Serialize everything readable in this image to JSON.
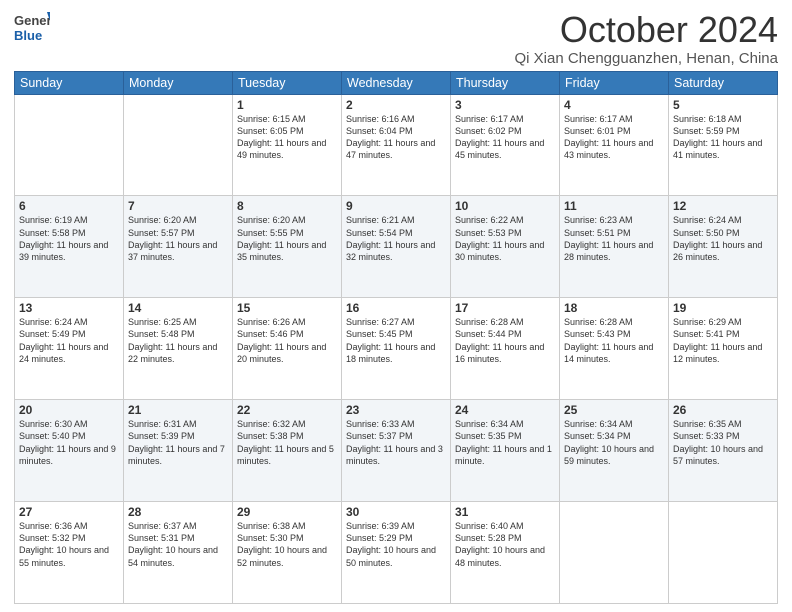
{
  "logo": {
    "text_general": "General",
    "text_blue": "Blue"
  },
  "title": {
    "month": "October 2024",
    "location": "Qi Xian Chengguanzhen, Henan, China"
  },
  "days_of_week": [
    "Sunday",
    "Monday",
    "Tuesday",
    "Wednesday",
    "Thursday",
    "Friday",
    "Saturday"
  ],
  "weeks": [
    [
      {
        "day": "",
        "sunrise": "",
        "sunset": "",
        "daylight": ""
      },
      {
        "day": "",
        "sunrise": "",
        "sunset": "",
        "daylight": ""
      },
      {
        "day": "1",
        "sunrise": "Sunrise: 6:15 AM",
        "sunset": "Sunset: 6:05 PM",
        "daylight": "Daylight: 11 hours and 49 minutes."
      },
      {
        "day": "2",
        "sunrise": "Sunrise: 6:16 AM",
        "sunset": "Sunset: 6:04 PM",
        "daylight": "Daylight: 11 hours and 47 minutes."
      },
      {
        "day": "3",
        "sunrise": "Sunrise: 6:17 AM",
        "sunset": "Sunset: 6:02 PM",
        "daylight": "Daylight: 11 hours and 45 minutes."
      },
      {
        "day": "4",
        "sunrise": "Sunrise: 6:17 AM",
        "sunset": "Sunset: 6:01 PM",
        "daylight": "Daylight: 11 hours and 43 minutes."
      },
      {
        "day": "5",
        "sunrise": "Sunrise: 6:18 AM",
        "sunset": "Sunset: 5:59 PM",
        "daylight": "Daylight: 11 hours and 41 minutes."
      }
    ],
    [
      {
        "day": "6",
        "sunrise": "Sunrise: 6:19 AM",
        "sunset": "Sunset: 5:58 PM",
        "daylight": "Daylight: 11 hours and 39 minutes."
      },
      {
        "day": "7",
        "sunrise": "Sunrise: 6:20 AM",
        "sunset": "Sunset: 5:57 PM",
        "daylight": "Daylight: 11 hours and 37 minutes."
      },
      {
        "day": "8",
        "sunrise": "Sunrise: 6:20 AM",
        "sunset": "Sunset: 5:55 PM",
        "daylight": "Daylight: 11 hours and 35 minutes."
      },
      {
        "day": "9",
        "sunrise": "Sunrise: 6:21 AM",
        "sunset": "Sunset: 5:54 PM",
        "daylight": "Daylight: 11 hours and 32 minutes."
      },
      {
        "day": "10",
        "sunrise": "Sunrise: 6:22 AM",
        "sunset": "Sunset: 5:53 PM",
        "daylight": "Daylight: 11 hours and 30 minutes."
      },
      {
        "day": "11",
        "sunrise": "Sunrise: 6:23 AM",
        "sunset": "Sunset: 5:51 PM",
        "daylight": "Daylight: 11 hours and 28 minutes."
      },
      {
        "day": "12",
        "sunrise": "Sunrise: 6:24 AM",
        "sunset": "Sunset: 5:50 PM",
        "daylight": "Daylight: 11 hours and 26 minutes."
      }
    ],
    [
      {
        "day": "13",
        "sunrise": "Sunrise: 6:24 AM",
        "sunset": "Sunset: 5:49 PM",
        "daylight": "Daylight: 11 hours and 24 minutes."
      },
      {
        "day": "14",
        "sunrise": "Sunrise: 6:25 AM",
        "sunset": "Sunset: 5:48 PM",
        "daylight": "Daylight: 11 hours and 22 minutes."
      },
      {
        "day": "15",
        "sunrise": "Sunrise: 6:26 AM",
        "sunset": "Sunset: 5:46 PM",
        "daylight": "Daylight: 11 hours and 20 minutes."
      },
      {
        "day": "16",
        "sunrise": "Sunrise: 6:27 AM",
        "sunset": "Sunset: 5:45 PM",
        "daylight": "Daylight: 11 hours and 18 minutes."
      },
      {
        "day": "17",
        "sunrise": "Sunrise: 6:28 AM",
        "sunset": "Sunset: 5:44 PM",
        "daylight": "Daylight: 11 hours and 16 minutes."
      },
      {
        "day": "18",
        "sunrise": "Sunrise: 6:28 AM",
        "sunset": "Sunset: 5:43 PM",
        "daylight": "Daylight: 11 hours and 14 minutes."
      },
      {
        "day": "19",
        "sunrise": "Sunrise: 6:29 AM",
        "sunset": "Sunset: 5:41 PM",
        "daylight": "Daylight: 11 hours and 12 minutes."
      }
    ],
    [
      {
        "day": "20",
        "sunrise": "Sunrise: 6:30 AM",
        "sunset": "Sunset: 5:40 PM",
        "daylight": "Daylight: 11 hours and 9 minutes."
      },
      {
        "day": "21",
        "sunrise": "Sunrise: 6:31 AM",
        "sunset": "Sunset: 5:39 PM",
        "daylight": "Daylight: 11 hours and 7 minutes."
      },
      {
        "day": "22",
        "sunrise": "Sunrise: 6:32 AM",
        "sunset": "Sunset: 5:38 PM",
        "daylight": "Daylight: 11 hours and 5 minutes."
      },
      {
        "day": "23",
        "sunrise": "Sunrise: 6:33 AM",
        "sunset": "Sunset: 5:37 PM",
        "daylight": "Daylight: 11 hours and 3 minutes."
      },
      {
        "day": "24",
        "sunrise": "Sunrise: 6:34 AM",
        "sunset": "Sunset: 5:35 PM",
        "daylight": "Daylight: 11 hours and 1 minute."
      },
      {
        "day": "25",
        "sunrise": "Sunrise: 6:34 AM",
        "sunset": "Sunset: 5:34 PM",
        "daylight": "Daylight: 10 hours and 59 minutes."
      },
      {
        "day": "26",
        "sunrise": "Sunrise: 6:35 AM",
        "sunset": "Sunset: 5:33 PM",
        "daylight": "Daylight: 10 hours and 57 minutes."
      }
    ],
    [
      {
        "day": "27",
        "sunrise": "Sunrise: 6:36 AM",
        "sunset": "Sunset: 5:32 PM",
        "daylight": "Daylight: 10 hours and 55 minutes."
      },
      {
        "day": "28",
        "sunrise": "Sunrise: 6:37 AM",
        "sunset": "Sunset: 5:31 PM",
        "daylight": "Daylight: 10 hours and 54 minutes."
      },
      {
        "day": "29",
        "sunrise": "Sunrise: 6:38 AM",
        "sunset": "Sunset: 5:30 PM",
        "daylight": "Daylight: 10 hours and 52 minutes."
      },
      {
        "day": "30",
        "sunrise": "Sunrise: 6:39 AM",
        "sunset": "Sunset: 5:29 PM",
        "daylight": "Daylight: 10 hours and 50 minutes."
      },
      {
        "day": "31",
        "sunrise": "Sunrise: 6:40 AM",
        "sunset": "Sunset: 5:28 PM",
        "daylight": "Daylight: 10 hours and 48 minutes."
      },
      {
        "day": "",
        "sunrise": "",
        "sunset": "",
        "daylight": ""
      },
      {
        "day": "",
        "sunrise": "",
        "sunset": "",
        "daylight": ""
      }
    ]
  ]
}
